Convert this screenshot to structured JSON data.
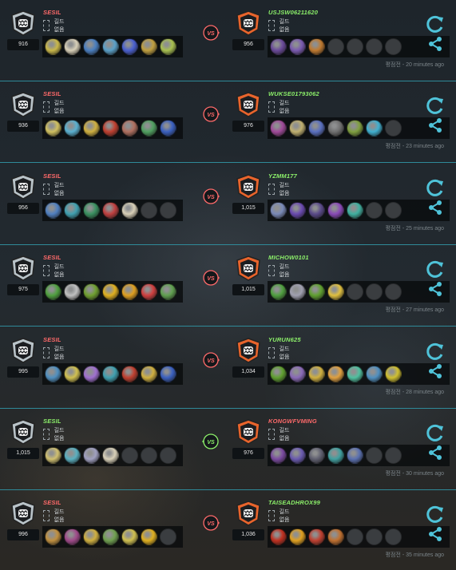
{
  "colors": {
    "divider": "#2f8a99",
    "accent_teal": "#4fc3d9",
    "name_loss": "#ff6a6a",
    "name_win": "#8cf06a",
    "emblem_silver": "#b9c3c8",
    "emblem_orange": "#e8642c"
  },
  "icons": {
    "emblem": "rank-emblem-icon",
    "guild": "guild-placeholder-icon",
    "vs": "vs-badge-icon",
    "refresh": "refresh-icon",
    "share": "share-icon"
  },
  "matches": [
    {
      "result": "loss",
      "left": {
        "name": "SESIL",
        "rating": "916",
        "guild": "길드 없음",
        "heroes": [
          "#c9b84a",
          "#d8d0b8",
          "#4a7fc0",
          "#5aa0c8",
          "#4a60d0",
          "#c0a040",
          "#a8c050"
        ]
      },
      "right": {
        "name": "USJSW06211620",
        "rating": "956",
        "guild": "길드 없음",
        "heroes": [
          "#6a4a9a",
          "#7a5ab0",
          "#c07a30",
          "empty",
          "empty",
          "empty",
          "empty"
        ]
      },
      "time": "평점전 - 20 minutes ago"
    },
    {
      "result": "loss",
      "left": {
        "name": "SESIL",
        "rating": "936",
        "guild": "길드 없음",
        "heroes": [
          "#d0c060",
          "#5ab0d0",
          "#d0b040",
          "#c04030",
          "#b07060",
          "#50a060",
          "#3a60c0"
        ]
      },
      "right": {
        "name": "WUKSE01793062",
        "rating": "976",
        "guild": "길드 없음",
        "heroes": [
          "#a04a9a",
          "#c0b070",
          "#5a70c0",
          "#707070",
          "#80a040",
          "#40b0d0",
          "empty"
        ]
      },
      "time": "평점전 - 23 minutes ago"
    },
    {
      "result": "loss",
      "left": {
        "name": "SESIL",
        "rating": "956",
        "guild": "길드 없음",
        "heroes": [
          "#5080c0",
          "#40a0b0",
          "#3a9060",
          "#c04040",
          "#d8d0b8",
          "empty",
          "empty"
        ]
      },
      "right": {
        "name": "YZMM177",
        "rating": "1,015",
        "guild": "길드 없음",
        "heroes": [
          "#7a8ab8",
          "#6a4ab0",
          "#5a4a8a",
          "#8a4ab8",
          "#40b0a0",
          "empty",
          "empty"
        ]
      },
      "time": "평점전 - 25 minutes ago"
    },
    {
      "result": "loss",
      "left": {
        "name": "SESIL",
        "rating": "975",
        "guild": "길드 없음",
        "heroes": [
          "#50a040",
          "#c0c0c0",
          "#70a030",
          "#e0b020",
          "#e0a020",
          "#d04040",
          "#60a050"
        ]
      },
      "right": {
        "name": "MICHOW0101",
        "rating": "1,015",
        "guild": "길드 없음",
        "heroes": [
          "#50a040",
          "#a0a0b0",
          "#60a030",
          "#e0c040",
          "empty",
          "empty",
          "empty"
        ]
      },
      "time": "평점전 - 27 minutes ago"
    },
    {
      "result": "loss",
      "left": {
        "name": "SESIL",
        "rating": "995",
        "guild": "길드 없음",
        "heroes": [
          "#5090c0",
          "#d0c050",
          "#a070d0",
          "#40a0b0",
          "#c04030",
          "#d0b040",
          "#3a60c0"
        ]
      },
      "right": {
        "name": "YURUN625",
        "rating": "1,034",
        "guild": "길드 없음",
        "heroes": [
          "#60a030",
          "#8a6ab8",
          "#d0b040",
          "#e0a040",
          "#50c0a0",
          "#5090c0",
          "#d0c030"
        ]
      },
      "time": "평점전 - 28 minutes ago"
    },
    {
      "result": "win",
      "left": {
        "name": "SESIL",
        "rating": "1,015",
        "guild": "길드 없음",
        "heroes": [
          "#d0c070",
          "#5ab0c0",
          "#a0a0c0",
          "#d8d0b8",
          "empty",
          "empty",
          "empty"
        ]
      },
      "right": {
        "name": "KONGWFVMING",
        "rating": "976",
        "guild": "길드 없음",
        "heroes": [
          "#7a4aa0",
          "#6a5ab0",
          "#606070",
          "#40a0a0",
          "#5a70b0",
          "empty",
          "empty"
        ]
      },
      "time": "평점전 - 30 minutes ago"
    },
    {
      "result": "loss",
      "left": {
        "name": "SESIL",
        "rating": "996",
        "guild": "길드 없음",
        "heroes": [
          "#c09040",
          "#a04a8a",
          "#d0b040",
          "#70a050",
          "#d0c050",
          "#e0b020",
          "empty"
        ]
      },
      "right": {
        "name": "TAISEADHROX99",
        "rating": "1,036",
        "guild": "길드 없음",
        "heroes": [
          "#c03020",
          "#e0a020",
          "#c04030",
          "#c07030",
          "empty",
          "empty",
          "empty"
        ]
      },
      "time": "평점전 - 35 minutes ago"
    }
  ]
}
